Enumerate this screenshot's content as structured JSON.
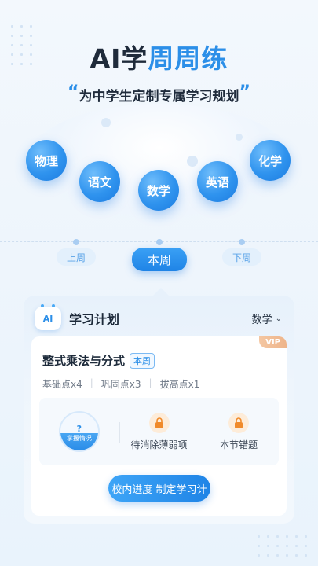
{
  "header": {
    "title_part1": "AI学",
    "title_part2": "周周练",
    "subtitle": "为中学生定制专属学习规划",
    "quote_open": "“",
    "quote_close": "”"
  },
  "subjects": [
    "物理",
    "语文",
    "数学",
    "英语",
    "化学"
  ],
  "weeks": {
    "prev": "上周",
    "current": "本周",
    "next": "下周"
  },
  "plan": {
    "icon_label": "AI",
    "title": "学习计划",
    "subject_selected": "数学",
    "card": {
      "vip": "VIP",
      "name": "整式乘法与分式",
      "tag": "本周",
      "points": [
        "基础点x4",
        "巩固点x3",
        "拔高点x1"
      ],
      "stats": {
        "mastery_mark": "?",
        "mastery_label": "掌握情况",
        "weak_label": "待消除薄弱项",
        "errors_label": "本节错题"
      },
      "cta": "校内进度 制定学习计"
    }
  },
  "colors": {
    "accent": "#2c8fe8",
    "lock_bg": "#fdecd9",
    "lock_fg": "#f08a2a",
    "vip": "#eeb48a"
  }
}
